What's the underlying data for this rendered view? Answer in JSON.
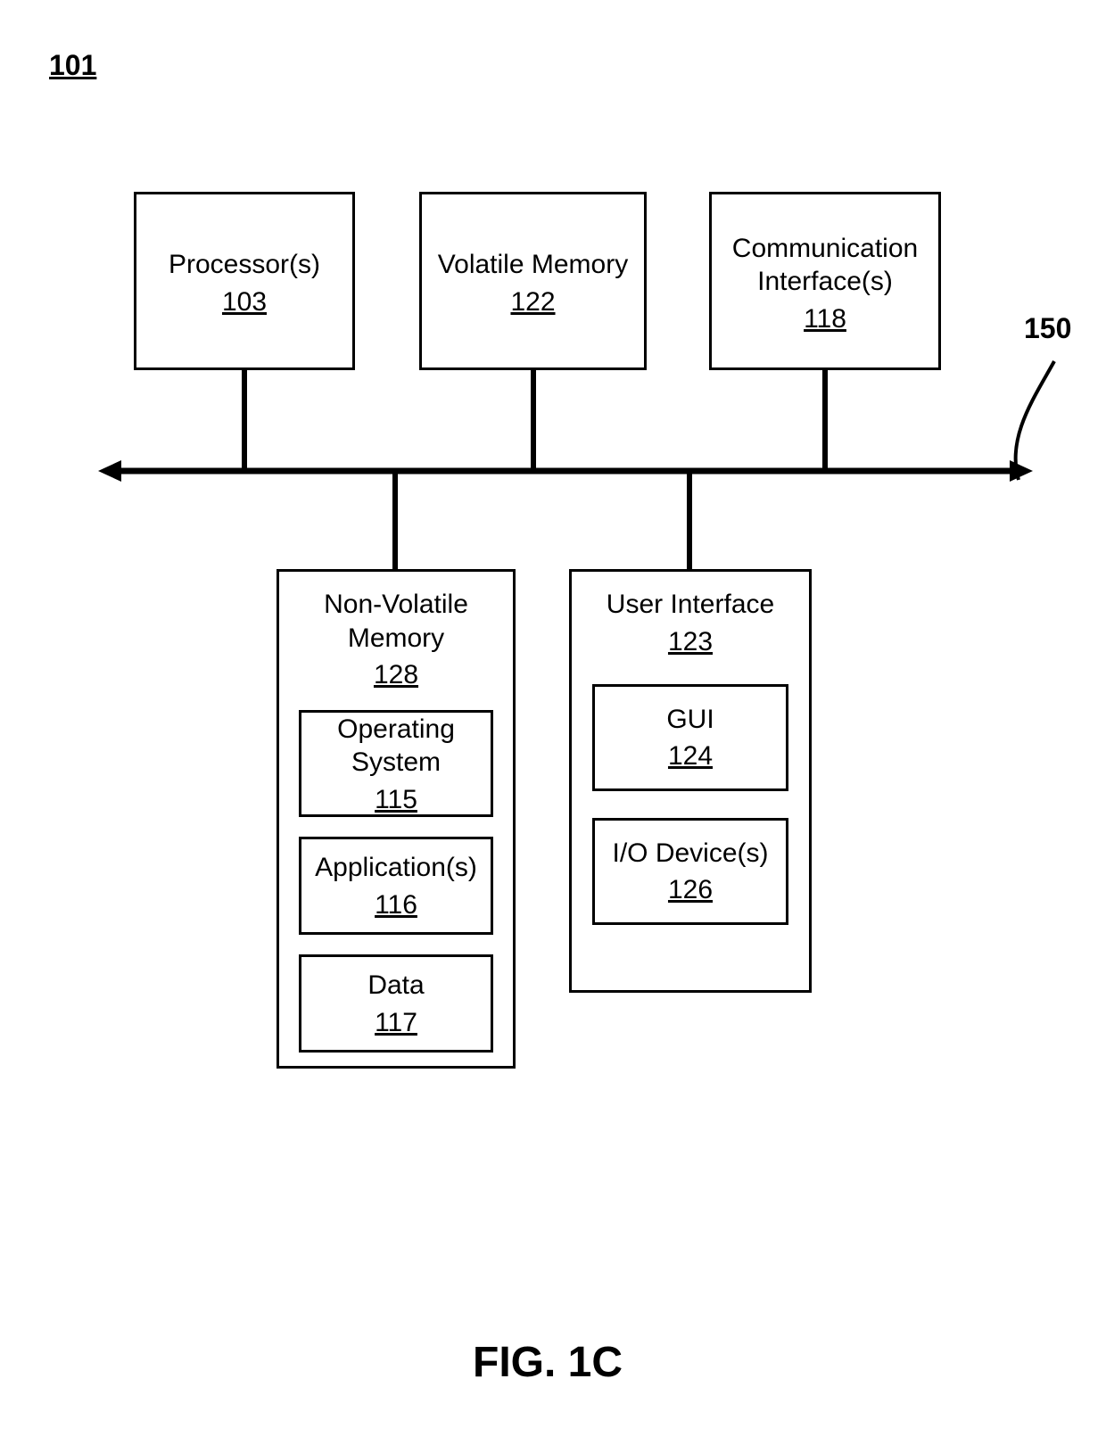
{
  "cornerRef": "101",
  "busRef": "150",
  "figCaption": "FIG. 1C",
  "topBoxes": {
    "processor": {
      "label": "Processor(s)",
      "ref": "103"
    },
    "volatile": {
      "label": "Volatile Memory",
      "ref": "122"
    },
    "comm": {
      "label": "Communication Interface(s)",
      "ref": "118"
    }
  },
  "nvMem": {
    "label": "Non-Volatile Memory",
    "ref": "128",
    "children": {
      "os": {
        "label": "Operating System",
        "ref": "115"
      },
      "apps": {
        "label": "Application(s)",
        "ref": "116"
      },
      "data": {
        "label": "Data",
        "ref": "117"
      }
    }
  },
  "ui": {
    "label": "User Interface",
    "ref": "123",
    "children": {
      "gui": {
        "label": "GUI",
        "ref": "124"
      },
      "io": {
        "label": "I/O Device(s)",
        "ref": "126"
      }
    }
  }
}
